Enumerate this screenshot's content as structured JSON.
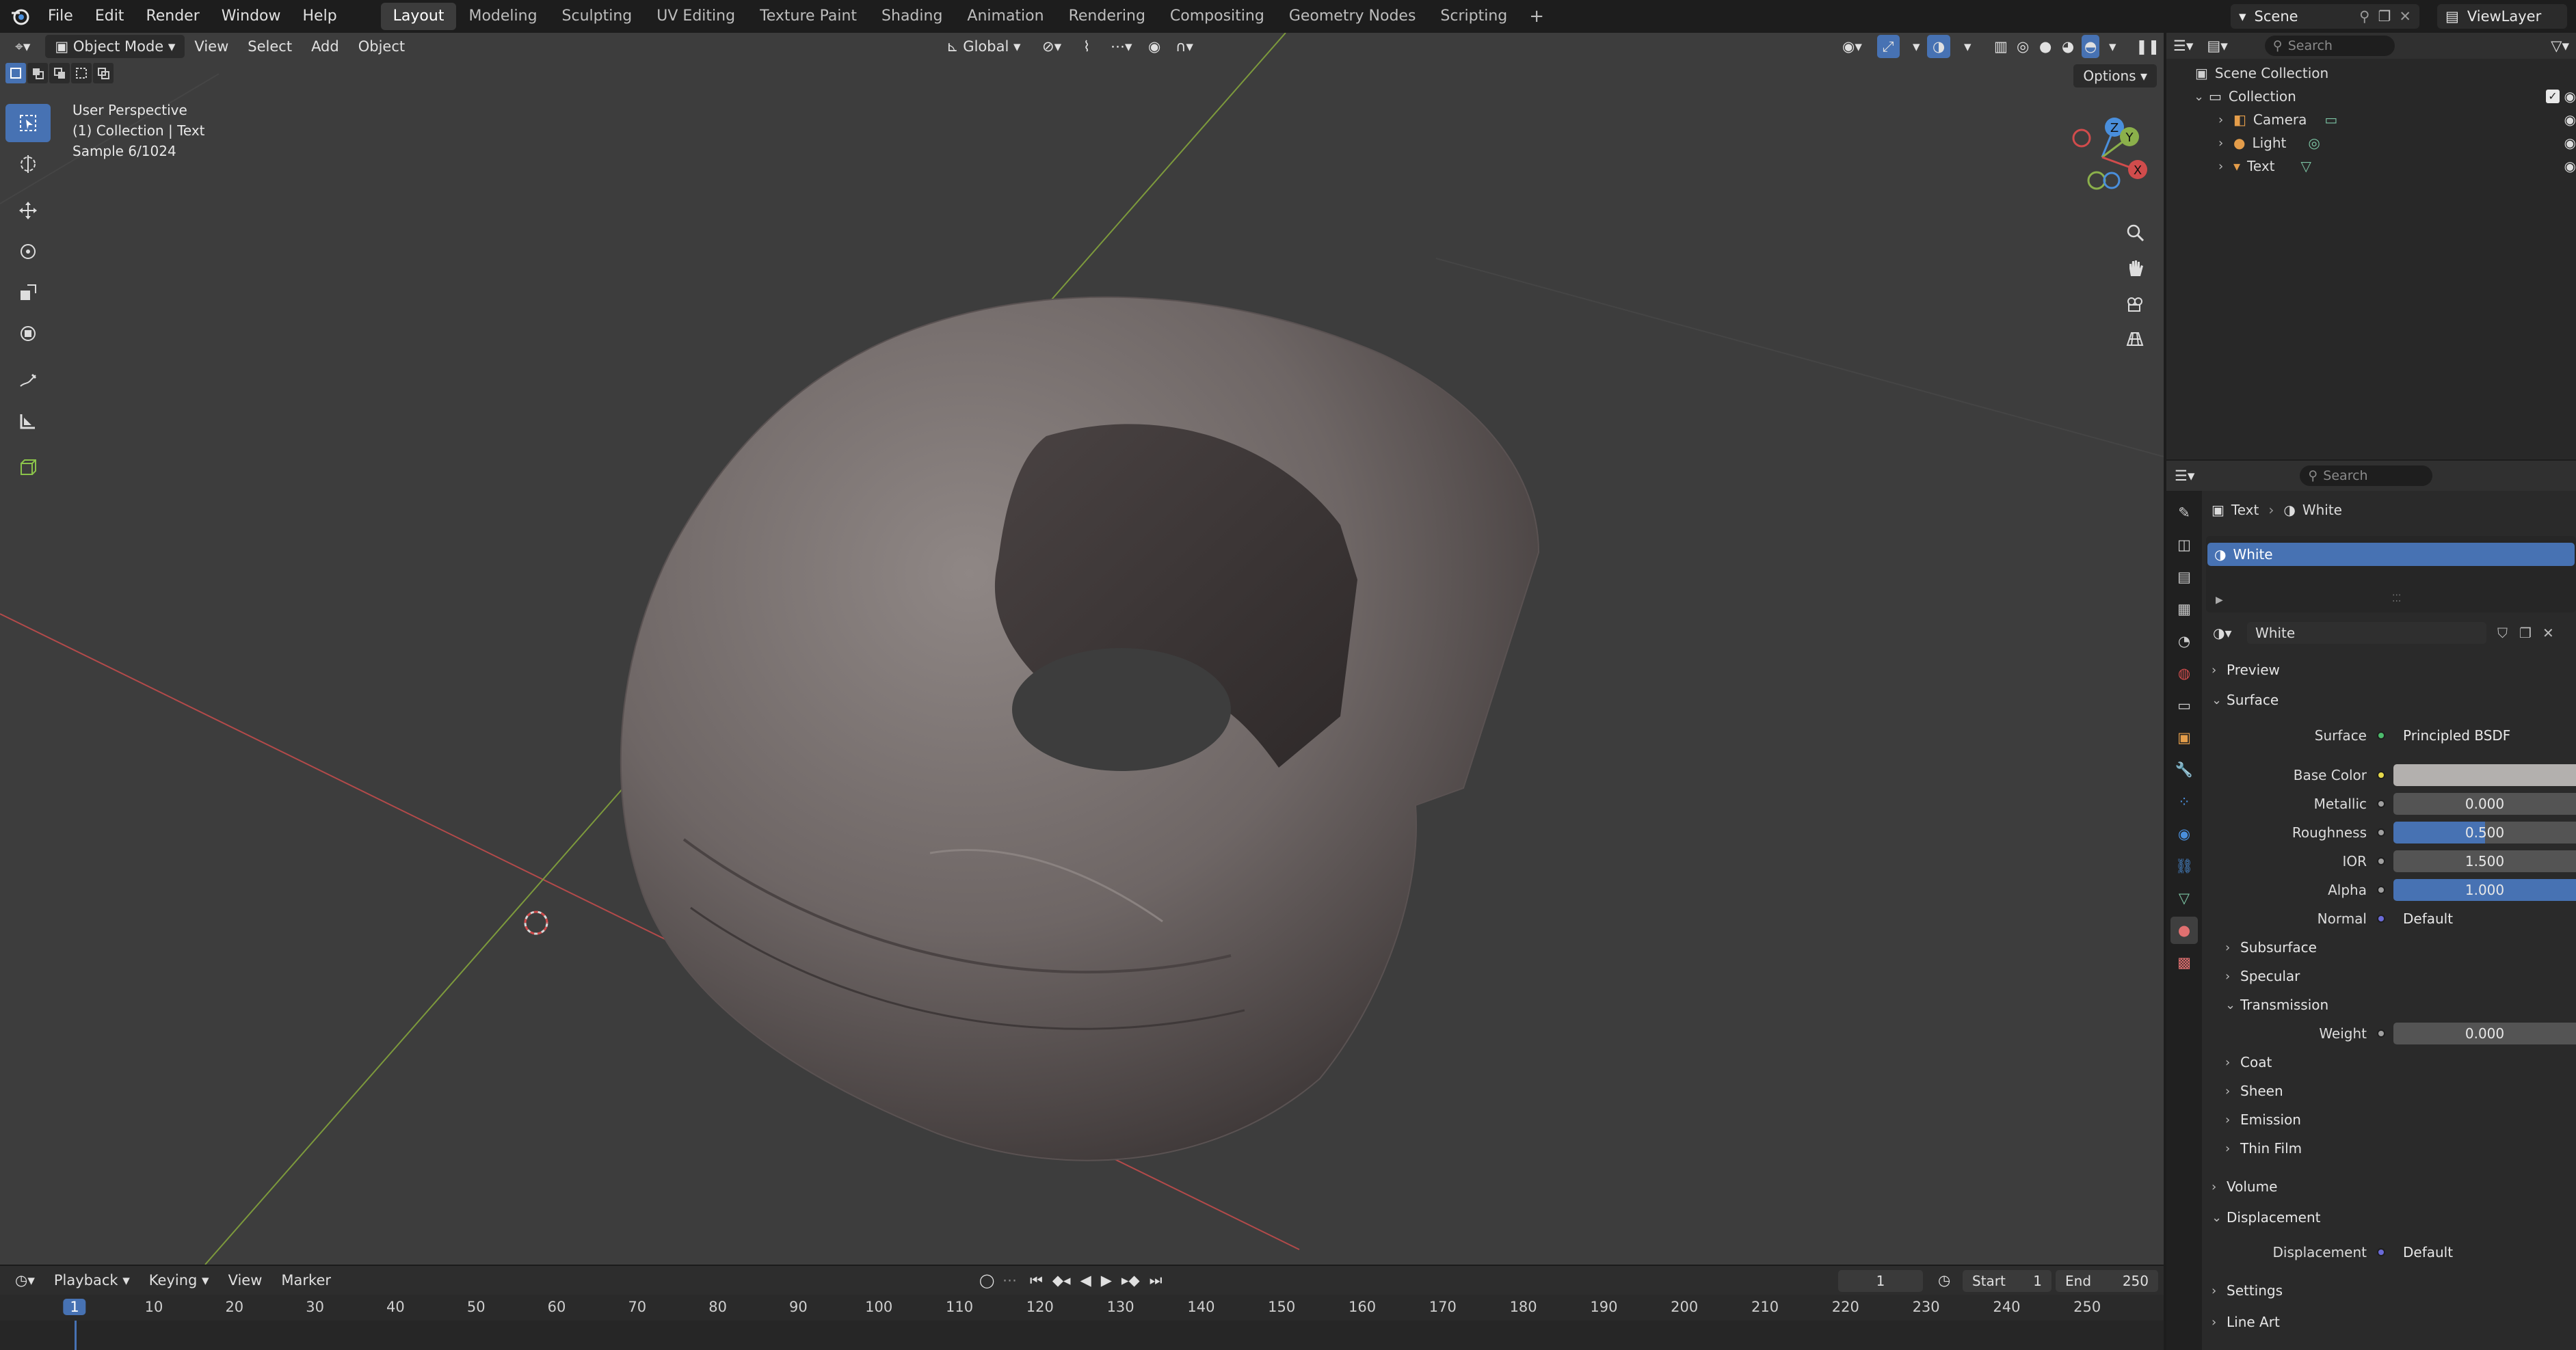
{
  "menu": [
    "File",
    "Edit",
    "Render",
    "Window",
    "Help"
  ],
  "workspaces": [
    {
      "label": "Layout",
      "active": true
    },
    {
      "label": "Modeling"
    },
    {
      "label": "Sculpting"
    },
    {
      "label": "UV Editing"
    },
    {
      "label": "Texture Paint"
    },
    {
      "label": "Shading"
    },
    {
      "label": "Animation"
    },
    {
      "label": "Rendering"
    },
    {
      "label": "Compositing"
    },
    {
      "label": "Geometry Nodes"
    },
    {
      "label": "Scripting"
    }
  ],
  "scene": {
    "name": "Scene",
    "view_layer": "ViewLayer"
  },
  "viewport": {
    "mode": "Object Mode",
    "menus": [
      "View",
      "Select",
      "Add",
      "Object"
    ],
    "transform_orientation": "Global",
    "options_label": "Options",
    "overlay": {
      "perspective": "User Perspective",
      "collection": "(1) Collection | Text",
      "sample": "Sample 6/1024"
    },
    "gizmo": {
      "x": "X",
      "y": "Y",
      "z": "Z"
    }
  },
  "outliner": {
    "search_placeholder": "Search",
    "scene_collection": "Scene Collection",
    "collection": "Collection",
    "items": [
      {
        "name": "Camera",
        "icon": "camera-icon"
      },
      {
        "name": "Light",
        "icon": "light-icon"
      },
      {
        "name": "Text",
        "icon": "text-icon"
      }
    ]
  },
  "properties": {
    "search_placeholder": "Search",
    "breadcrumb_object": "Text",
    "breadcrumb_material": "White",
    "slot_name": "White",
    "material_name": "White",
    "sections": {
      "preview": "Preview",
      "surface": "Surface",
      "subsurface": "Subsurface",
      "specular": "Specular",
      "transmission": "Transmission",
      "coat": "Coat",
      "sheen": "Sheen",
      "emission": "Emission",
      "thin_film": "Thin Film",
      "volume": "Volume",
      "displacement": "Displacement",
      "settings": "Settings",
      "line_art": "Line Art"
    },
    "fields": {
      "surface_label": "Surface",
      "surface_value": "Principled BSDF",
      "base_color_label": "Base Color",
      "base_color": "#b3b0ae",
      "metallic_label": "Metallic",
      "metallic": "0.000",
      "roughness_label": "Roughness",
      "roughness": "0.500",
      "roughness_fraction": 0.5,
      "ior_label": "IOR",
      "ior": "1.500",
      "alpha_label": "Alpha",
      "alpha": "1.000",
      "alpha_fraction": 1.0,
      "normal_label": "Normal",
      "normal": "Default",
      "weight_label": "Weight",
      "weight": "0.000",
      "displacement_label": "Displacement",
      "displacement": "Default"
    }
  },
  "timeline": {
    "menus": [
      "Playback",
      "Keying",
      "View",
      "Marker"
    ],
    "current_frame": "1",
    "start_label": "Start",
    "start": "1",
    "end_label": "End",
    "end": "250",
    "ticks": [
      "1",
      "10",
      "20",
      "30",
      "40",
      "50",
      "60",
      "70",
      "80",
      "90",
      "100",
      "110",
      "120",
      "130",
      "140",
      "150",
      "160",
      "170",
      "180",
      "190",
      "200",
      "210",
      "220",
      "230",
      "240",
      "250"
    ]
  },
  "colors": {
    "accent": "#4772b3",
    "viewport_bg": "#3d3d3d",
    "x_axis": "#d14c4c",
    "y_axis": "#8bb04b",
    "z_axis": "#4a8fdc"
  }
}
